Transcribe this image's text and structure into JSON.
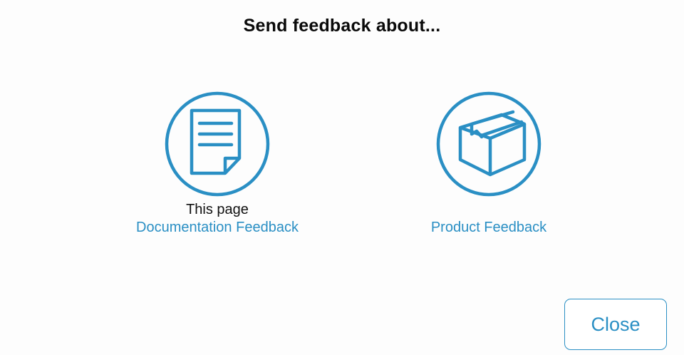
{
  "dialog": {
    "title": "Send feedback about..."
  },
  "options": [
    {
      "icon": "document-icon",
      "subtitle": "This page",
      "link_label": "Documentation Feedback"
    },
    {
      "icon": "box-icon",
      "subtitle": "",
      "link_label": "Product Feedback"
    }
  ],
  "footer": {
    "close_label": "Close"
  },
  "colors": {
    "accent": "#2a8fc4",
    "title_text": "#0a0a0a",
    "body_text": "#111111",
    "background": "#fdfdfd"
  }
}
